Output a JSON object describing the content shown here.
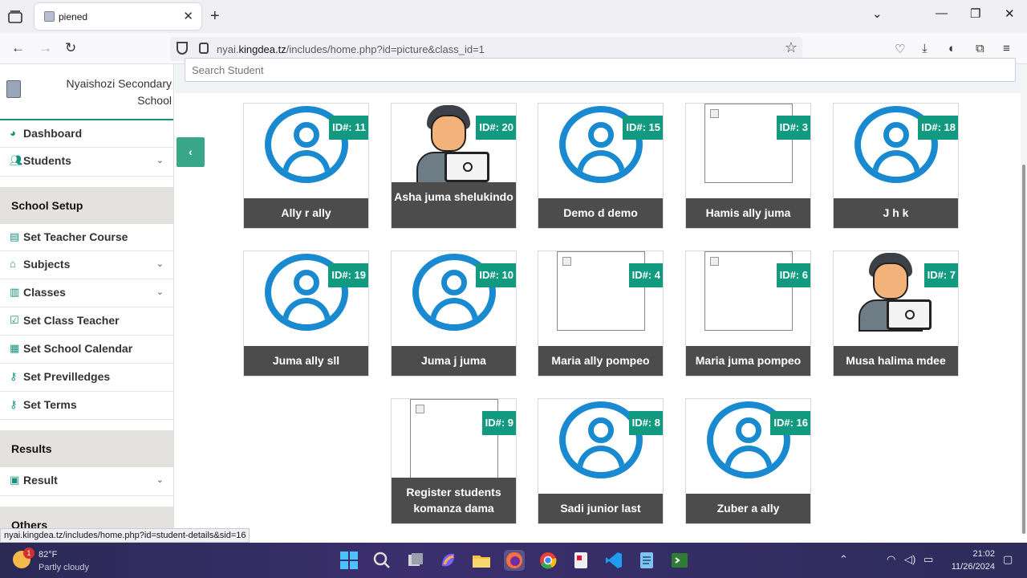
{
  "browser": {
    "tab_title": "piened",
    "url_prefix": "nyai.",
    "url_domain": "kingdea.tz",
    "url_path": "/includes/home.php?id=picture&class_id=1",
    "status_url": "nyai.kingdea.tz/includes/home.php?id=student-details&sid=16"
  },
  "sidebar": {
    "school_name": "Nyaishozi Secondary School",
    "items_top": [
      {
        "label": "Dashboard",
        "icon": "dashboard-icon"
      },
      {
        "label": "Students",
        "icon": "users-icon"
      }
    ],
    "section_setup": "School Setup",
    "items_setup": [
      {
        "label": "Set Teacher Course",
        "icon": "book-icon"
      },
      {
        "label": "Subjects",
        "icon": "bank-icon"
      },
      {
        "label": "Classes",
        "icon": "building-icon"
      },
      {
        "label": "Set Class Teacher",
        "icon": "check-square-icon"
      },
      {
        "label": "Set School Calendar",
        "icon": "calendar-icon"
      },
      {
        "label": "Set Previlledges",
        "icon": "key-icon"
      },
      {
        "label": "Set Terms",
        "icon": "key-icon"
      }
    ],
    "section_results": "Results",
    "items_results": [
      {
        "label": "Result",
        "icon": "id-card-icon"
      }
    ],
    "section_others": "Others"
  },
  "main": {
    "search_placeholder": "Search Student",
    "toggle_label": "‹",
    "students": [
      {
        "id": "ID#: 11",
        "name": "Ally r ally",
        "photo": "avatar"
      },
      {
        "id": "ID#: 20",
        "name": "Asha juma shelukindo",
        "photo": "person"
      },
      {
        "id": "ID#: 15",
        "name": "Demo d demo",
        "photo": "avatar"
      },
      {
        "id": "ID#: 3",
        "name": "Hamis ally juma",
        "photo": "broken"
      },
      {
        "id": "ID#: 18",
        "name": "J h k",
        "photo": "avatar"
      },
      {
        "id": "ID#: 19",
        "name": "Juma ally sll",
        "photo": "avatar"
      },
      {
        "id": "ID#: 10",
        "name": "Juma j juma",
        "photo": "avatar"
      },
      {
        "id": "ID#: 4",
        "name": "Maria ally pompeo",
        "photo": "broken"
      },
      {
        "id": "ID#: 6",
        "name": "Maria juma pompeo",
        "photo": "broken"
      },
      {
        "id": "ID#: 7",
        "name": "Musa halima mdee",
        "photo": "person"
      },
      {
        "id": "ID#: 9",
        "name": "Register students komanza dama",
        "photo": "broken"
      },
      {
        "id": "ID#: 8",
        "name": "Sadi junior last",
        "photo": "avatar"
      },
      {
        "id": "ID#: 16",
        "name": "Zuber a ally",
        "photo": "avatar"
      }
    ]
  },
  "taskbar": {
    "weather_temp": "82°F",
    "weather_desc": "Partly cloudy",
    "notification_count": "1",
    "time": "21:02",
    "date": "11/26/2024"
  }
}
